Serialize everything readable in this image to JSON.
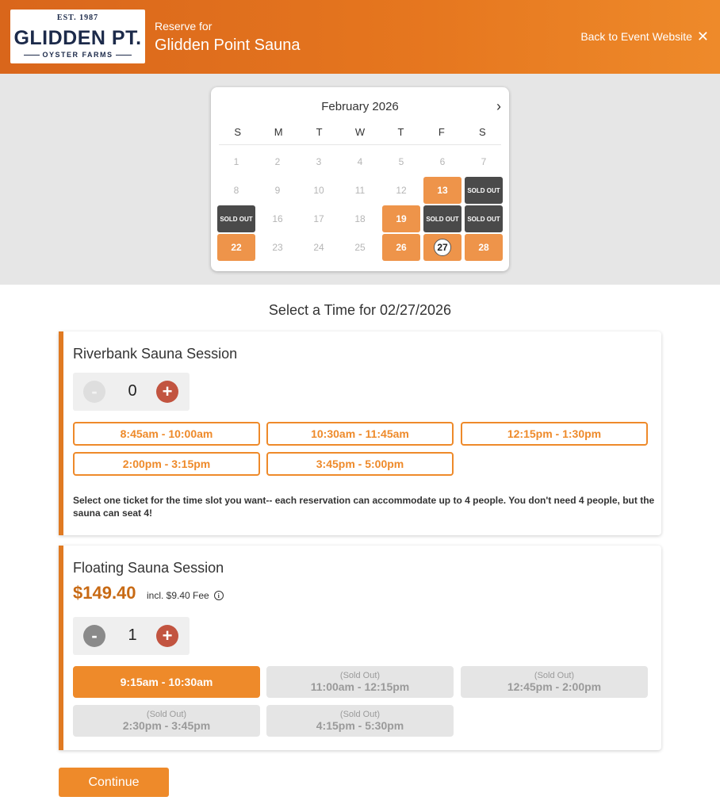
{
  "header": {
    "logo": {
      "est": "EST. 1987",
      "name": "GLIDDEN PT.",
      "sub": "OYSTER FARMS"
    },
    "reserve_for": "Reserve for",
    "venue": "Glidden Point Sauna",
    "back_link": "Back to Event Website",
    "close_glyph": "✕"
  },
  "calendar": {
    "month": "February 2026",
    "next_glyph": "›",
    "weekdays": [
      "S",
      "M",
      "T",
      "W",
      "T",
      "F",
      "S"
    ],
    "days": [
      {
        "label": "1",
        "state": "unavailable"
      },
      {
        "label": "2",
        "state": "unavailable"
      },
      {
        "label": "3",
        "state": "unavailable"
      },
      {
        "label": "4",
        "state": "unavailable"
      },
      {
        "label": "5",
        "state": "unavailable"
      },
      {
        "label": "6",
        "state": "unavailable"
      },
      {
        "label": "7",
        "state": "unavailable"
      },
      {
        "label": "8",
        "state": "unavailable"
      },
      {
        "label": "9",
        "state": "unavailable"
      },
      {
        "label": "10",
        "state": "unavailable"
      },
      {
        "label": "11",
        "state": "unavailable"
      },
      {
        "label": "12",
        "state": "unavailable"
      },
      {
        "label": "13",
        "state": "available"
      },
      {
        "label": "SOLD OUT",
        "state": "sold"
      },
      {
        "label": "SOLD OUT",
        "state": "sold"
      },
      {
        "label": "16",
        "state": "unavailable"
      },
      {
        "label": "17",
        "state": "unavailable"
      },
      {
        "label": "18",
        "state": "unavailable"
      },
      {
        "label": "19",
        "state": "available"
      },
      {
        "label": "SOLD OUT",
        "state": "sold"
      },
      {
        "label": "SOLD OUT",
        "state": "sold"
      },
      {
        "label": "22",
        "state": "available"
      },
      {
        "label": "23",
        "state": "unavailable"
      },
      {
        "label": "24",
        "state": "unavailable"
      },
      {
        "label": "25",
        "state": "unavailable"
      },
      {
        "label": "26",
        "state": "available"
      },
      {
        "label": "27",
        "state": "selected"
      },
      {
        "label": "28",
        "state": "available"
      }
    ]
  },
  "select_title": "Select a Time for 02/27/2026",
  "sessions": [
    {
      "title": "Riverbank Sauna Session",
      "minus": "-",
      "qty": "0",
      "plus": "+",
      "slots": [
        {
          "time": "8:45am - 10:00am",
          "state": "open"
        },
        {
          "time": "10:30am - 11:45am",
          "state": "open"
        },
        {
          "time": "12:15pm - 1:30pm",
          "state": "open"
        },
        {
          "time": "2:00pm - 3:15pm",
          "state": "open"
        },
        {
          "time": "3:45pm - 5:00pm",
          "state": "open"
        }
      ],
      "note": "Select one ticket for the time slot you want-- each reservation can accommodate up to 4 people. You don't need 4 people, but the sauna can seat 4!"
    },
    {
      "title": "Floating Sauna Session",
      "price": "$149.40",
      "fee": "incl. $9.40 Fee",
      "minus": "-",
      "qty": "1",
      "plus": "+",
      "sold_label": "(Sold Out)",
      "slots": [
        {
          "time": "9:15am - 10:30am",
          "state": "chosen"
        },
        {
          "time": "11:00am - 12:15pm",
          "state": "soldout"
        },
        {
          "time": "12:45pm - 2:00pm",
          "state": "soldout"
        },
        {
          "time": "2:30pm - 3:45pm",
          "state": "soldout"
        },
        {
          "time": "4:15pm - 5:30pm",
          "state": "soldout"
        }
      ]
    }
  ],
  "continue_label": "Continue",
  "colors": {
    "accent": "#ee8a2a",
    "sold": "#4a4a4a",
    "plus": "#c25440"
  }
}
